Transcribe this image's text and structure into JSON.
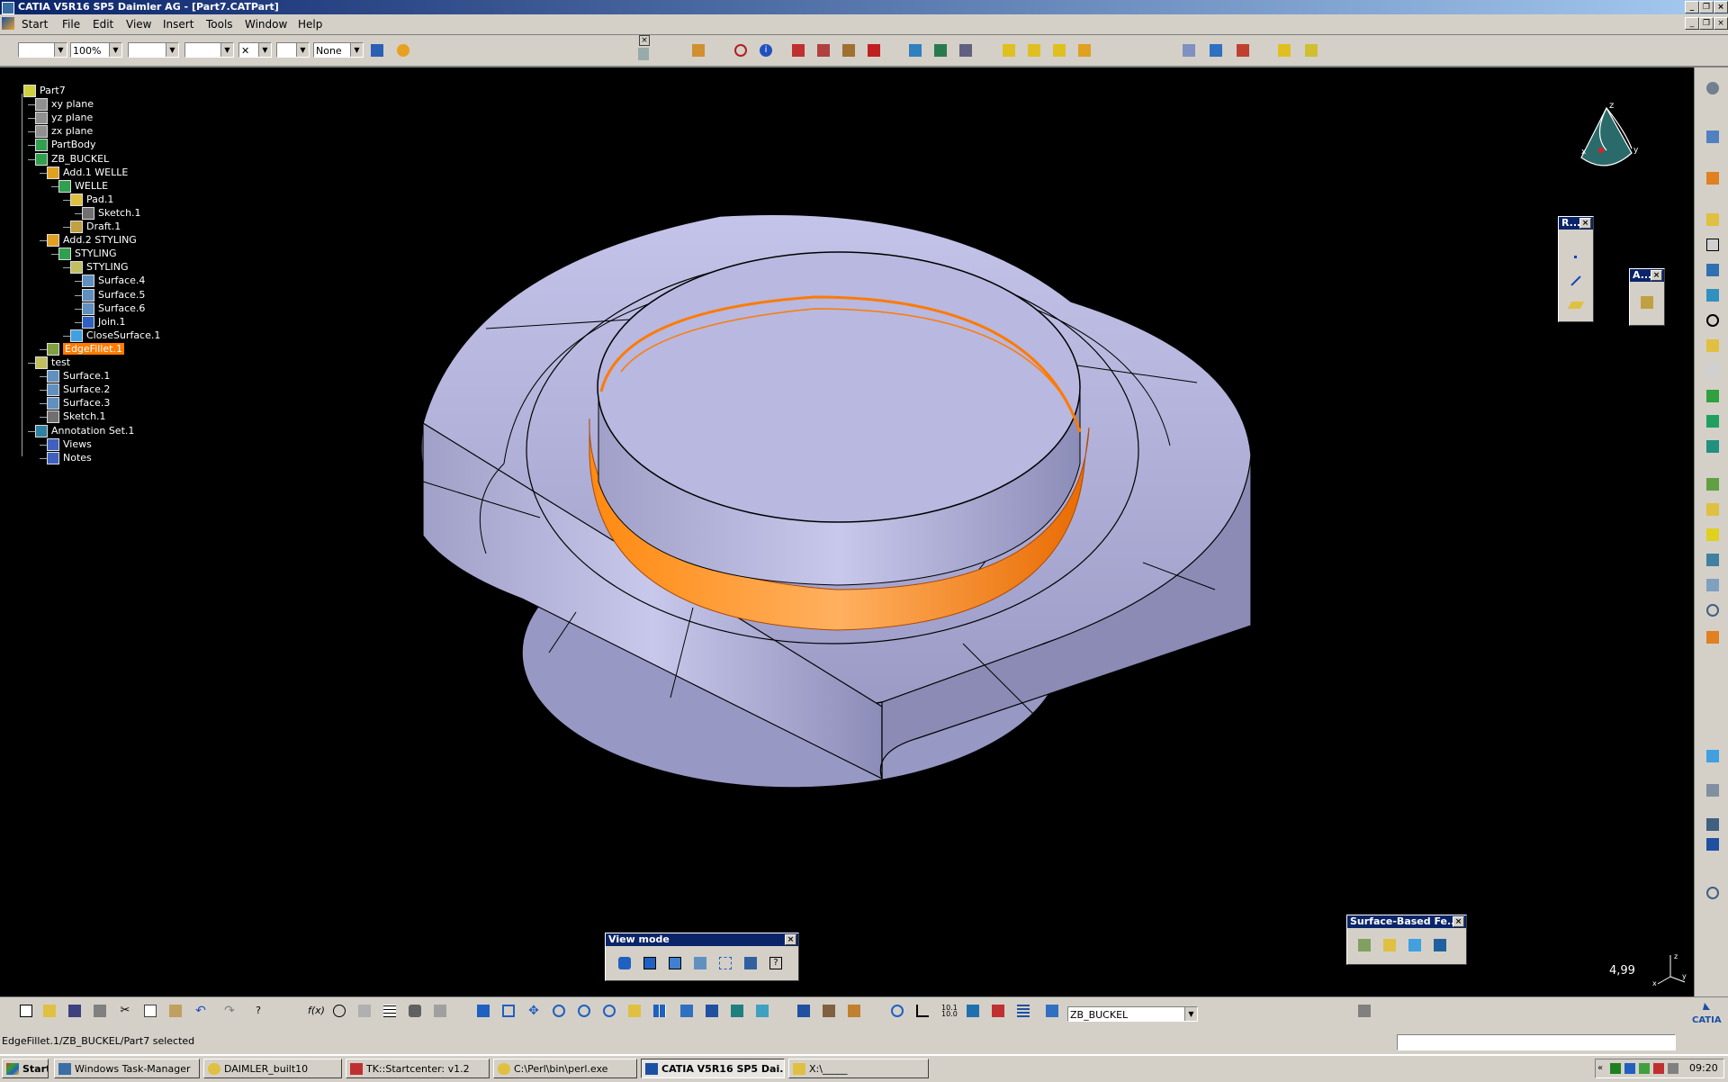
{
  "window": {
    "title": "CATIA V5R16 SP5 Daimler AG - [Part7.CATPart]"
  },
  "menu": [
    "Start",
    "File",
    "Edit",
    "View",
    "Insert",
    "Tools",
    "Window",
    "Help"
  ],
  "toolbar": {
    "zoom_value": "100%",
    "layer_value": "None"
  },
  "tree": {
    "nodes": [
      {
        "label": "Part7",
        "icon": "part-icon"
      },
      {
        "label": "xy plane",
        "icon": "plane-icon"
      },
      {
        "label": "yz plane",
        "icon": "plane-icon"
      },
      {
        "label": "zx plane",
        "icon": "plane-icon"
      },
      {
        "label": "PartBody",
        "icon": "body-icon"
      },
      {
        "label": "ZB_BUCKEL",
        "icon": "body-icon"
      },
      {
        "label": "Add.1   WELLE",
        "icon": "add-icon"
      },
      {
        "label": "WELLE",
        "icon": "body-icon"
      },
      {
        "label": "Pad.1",
        "icon": "pad-icon"
      },
      {
        "label": "Sketch.1",
        "icon": "sketch-icon"
      },
      {
        "label": "Draft.1",
        "icon": "draft-icon"
      },
      {
        "label": "Add.2   STYLING",
        "icon": "add-icon"
      },
      {
        "label": "STYLING",
        "icon": "body-icon"
      },
      {
        "label": "STYLING",
        "icon": "geoset-icon"
      },
      {
        "label": "Surface.4",
        "icon": "surface-icon"
      },
      {
        "label": "Surface.5",
        "icon": "surface-icon"
      },
      {
        "label": "Surface.6",
        "icon": "surface-icon"
      },
      {
        "label": "Join.1",
        "icon": "join-icon"
      },
      {
        "label": "CloseSurface.1",
        "icon": "closesurface-icon"
      },
      {
        "label": "EdgeFillet.1",
        "icon": "edgefillet-icon",
        "selected": true
      },
      {
        "label": "test",
        "icon": "geoset-icon"
      },
      {
        "label": "Surface.1",
        "icon": "surface-icon"
      },
      {
        "label": "Surface.2",
        "icon": "surface-icon"
      },
      {
        "label": "Surface.3",
        "icon": "surface-icon"
      },
      {
        "label": "Sketch.1",
        "icon": "sketch-icon"
      },
      {
        "label": "Annotation Set.1",
        "icon": "annotation-icon"
      },
      {
        "label": "Views",
        "icon": "views-icon"
      },
      {
        "label": "Notes",
        "icon": "notes-icon"
      }
    ]
  },
  "palettes": {
    "r_title": "R...",
    "a_title": "A...",
    "view_mode_title": "View mode",
    "surface_based_title": "Surface-Based Fe..."
  },
  "viewport": {
    "scale_readout": "4,99"
  },
  "bottom": {
    "current_body": "ZB_BUCKEL"
  },
  "status": {
    "message": "EdgeFillet.1/ZB_BUCKEL/Part7 selected"
  },
  "taskbar": {
    "start_label": "Start",
    "tasks": [
      {
        "label": "Windows Task-Manager"
      },
      {
        "label": "DAIMLER_built10"
      },
      {
        "label": "TK::Startcenter:  v1.2"
      },
      {
        "label": "C:\\Perl\\bin\\perl.exe"
      },
      {
        "label": "CATIA V5R16 SP5 Dai...",
        "active": true
      },
      {
        "label": "X:\\_____"
      }
    ],
    "clock": "09:20"
  },
  "colors": {
    "highlight": "#ff7a00",
    "part_surface": "#b8b8e0",
    "titlebar": "#0a246a"
  }
}
